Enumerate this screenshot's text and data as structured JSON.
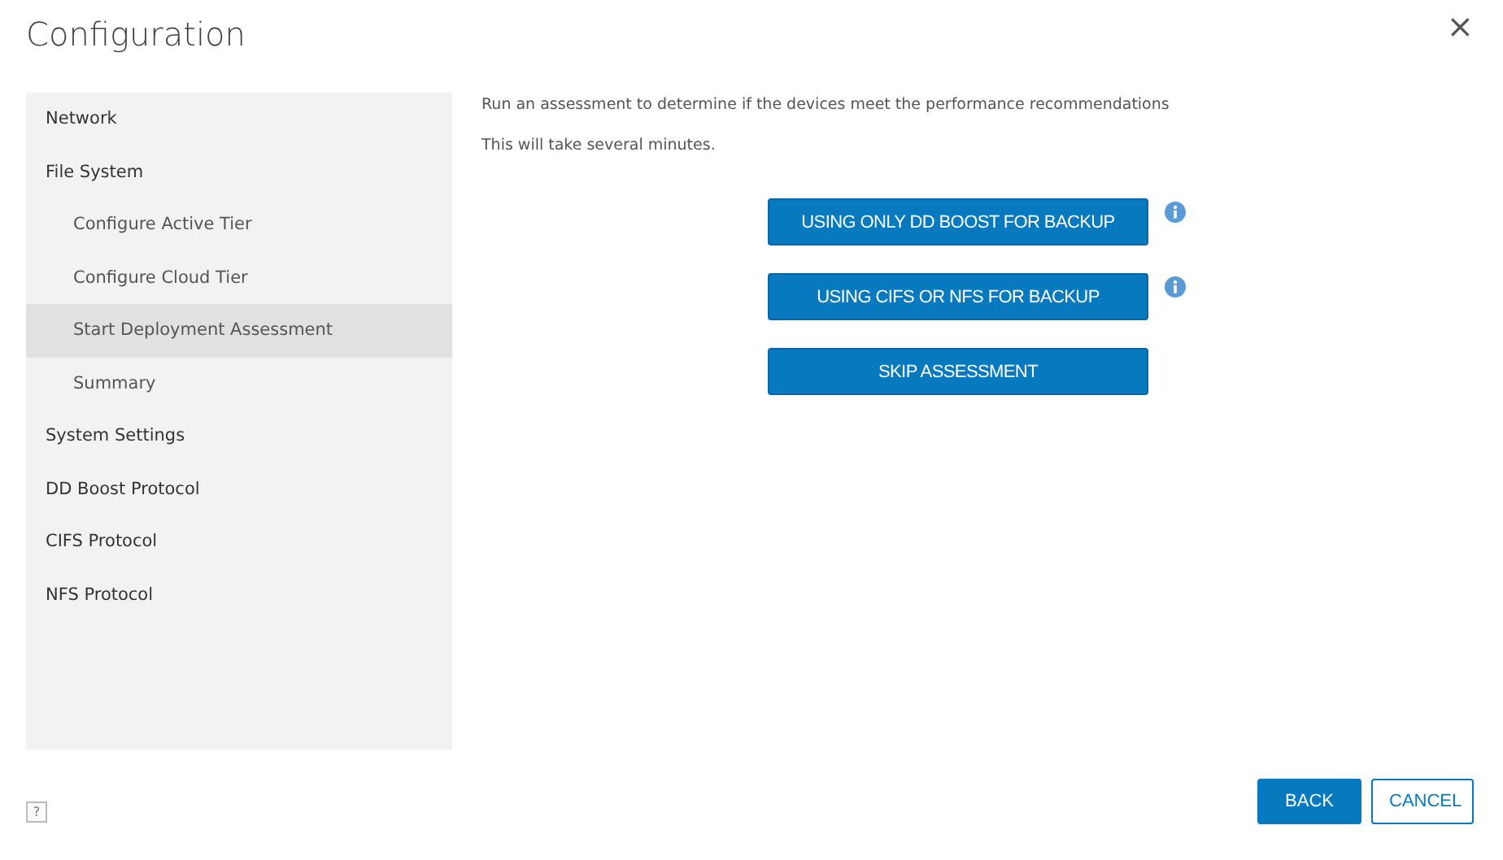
{
  "window": {
    "title": "Configuration",
    "close": "×"
  },
  "sidebar": {
    "items": [
      {
        "label": "Network",
        "selected": false
      },
      {
        "label": "File System",
        "selected": false,
        "children": [
          {
            "label": "Configure Active Tier",
            "selected": false
          },
          {
            "label": "Configure Cloud Tier",
            "selected": false
          },
          {
            "label": "Start Deployment Assessment",
            "selected": true
          },
          {
            "label": "Summary",
            "selected": false
          }
        ]
      },
      {
        "label": "System Settings",
        "selected": false
      },
      {
        "label": "DD Boost Protocol",
        "selected": false
      },
      {
        "label": "CIFS Protocol",
        "selected": false
      },
      {
        "label": "NFS Protocol",
        "selected": false
      }
    ]
  },
  "content": {
    "lines": [
      "Run an assessment to determine if the devices meet the performance recommendations",
      "This will take several minutes."
    ],
    "actions": [
      {
        "label": "USING ONLY DD BOOST FOR BACKUP",
        "info": true
      },
      {
        "label": "USING CIFS OR NFS FOR BACKUP",
        "info": true
      },
      {
        "label": "SKIP ASSESSMENT",
        "info": false
      }
    ]
  },
  "footer": {
    "help": "?",
    "buttons": [
      {
        "label": "BACK",
        "kind": "primary"
      },
      {
        "label": "CANCEL",
        "kind": "outline"
      }
    ]
  }
}
